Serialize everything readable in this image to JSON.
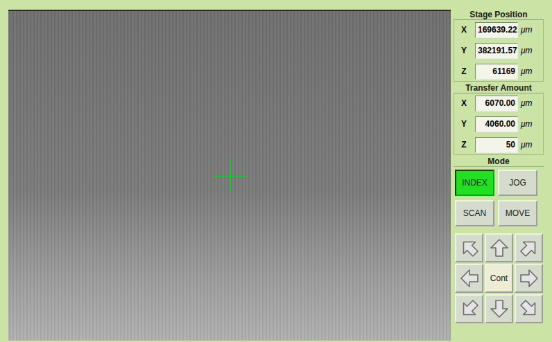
{
  "stage_position": {
    "title": "Stage Position",
    "rows": [
      {
        "axis": "X",
        "value": "169639.22",
        "unit": "μm"
      },
      {
        "axis": "Y",
        "value": "382191.57",
        "unit": "μm"
      },
      {
        "axis": "Z",
        "value": "61169",
        "unit": "μm"
      }
    ]
  },
  "transfer_amount": {
    "title": "Transfer Amount",
    "rows": [
      {
        "axis": "X",
        "value": "6070.00",
        "unit": "μm"
      },
      {
        "axis": "Y",
        "value": "4060.00",
        "unit": "μm"
      },
      {
        "axis": "Z",
        "value": "50",
        "unit": "μm"
      }
    ]
  },
  "mode": {
    "title": "Mode",
    "buttons": [
      {
        "label": "INDEX",
        "selected": true
      },
      {
        "label": "JOG",
        "selected": false
      },
      {
        "label": "SCAN",
        "selected": false
      },
      {
        "label": "MOVE",
        "selected": false
      }
    ]
  },
  "jog_pad": {
    "center": "Cont"
  }
}
